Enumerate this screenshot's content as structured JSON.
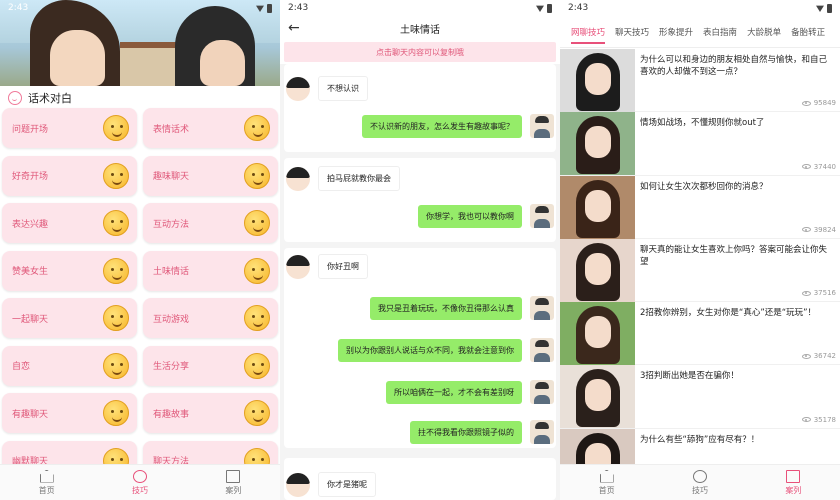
{
  "screen1": {
    "time": "2:43",
    "section_title": "话术对白",
    "cells": [
      "问题开场",
      "表情话术",
      "好奇开场",
      "趣味聊天",
      "表达兴趣",
      "互动方法",
      "赞美女生",
      "土味情话",
      "一起聊天",
      "互动游戏",
      "自恋",
      "生活分享",
      "有趣聊天",
      "有趣故事",
      "幽默聊天",
      "聊天方法"
    ],
    "tabbar": {
      "home": "首页",
      "tips": "技巧",
      "cases": "案列"
    }
  },
  "screen2": {
    "time": "2:43",
    "title": "土味情话",
    "back_icon": "arrow-left-icon",
    "notice": "点击聊天内容可以复制哦",
    "messages": [
      {
        "side": "left",
        "text": "不想认识"
      },
      {
        "side": "right",
        "text": "不认识新的朋友，怎么发生有趣故事呢？"
      },
      {
        "side": "left",
        "text": "拍马屁就教你最会"
      },
      {
        "side": "right",
        "text": "你想学，我也可以教你啊"
      },
      {
        "side": "left",
        "text": "你好丑啊"
      },
      {
        "side": "right",
        "text": "我只是丑着玩玩，不像你丑得那么认真"
      },
      {
        "side": "right",
        "text": "别以为你跟别人说话与众不同，我就会注意到你"
      },
      {
        "side": "right",
        "text": "所以咱俩在一起，才不会有差别呀"
      },
      {
        "side": "right",
        "text": "拄不得我看你跟照镜子似的"
      },
      {
        "side": "left",
        "text": "你才是猪呢"
      }
    ]
  },
  "screen3": {
    "time": "2:43",
    "tabs": [
      "网聊技巧",
      "聊天技巧",
      "形象提升",
      "表白指南",
      "大龄脱单",
      "备胎转正"
    ],
    "active_tab": 0,
    "articles": [
      {
        "title": "为什么可以和身边的朋友相处自然与愉快，和自己喜欢的人却做不到这一点？",
        "views": "95849"
      },
      {
        "title": "情场如战场，不懂规则你就out了",
        "views": "37440"
      },
      {
        "title": "如何让女生次次都秒回你的消息？",
        "views": "39824"
      },
      {
        "title": "聊天真的能让女生喜欢上你吗？答案可能会让你失望",
        "views": "37516"
      },
      {
        "title": "2招教你辨别，女生对你是“真心”还是“玩玩”！",
        "views": "36742"
      },
      {
        "title": "3招判断出她是否在骗你！",
        "views": "35178"
      },
      {
        "title": "为什么有些“舔狗”应有尽有？！",
        "views": ""
      }
    ],
    "tabbar": {
      "home": "首页",
      "tips": "技巧",
      "cases": "案列"
    }
  }
}
